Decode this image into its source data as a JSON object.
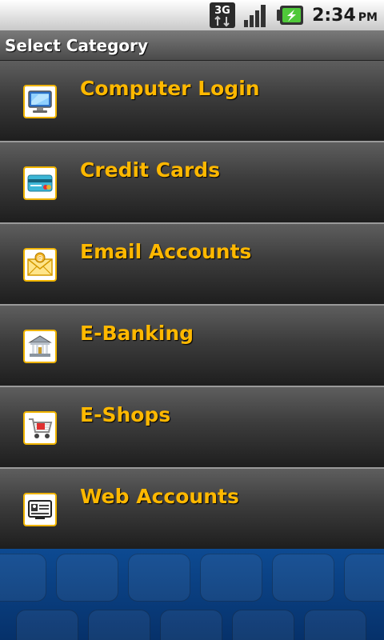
{
  "status_bar": {
    "network": "3G",
    "time": "2:34",
    "ampm": "PM",
    "icons": [
      "3g-data-icon",
      "signal-strength-icon",
      "battery-charging-icon"
    ]
  },
  "header": {
    "title": "Select Category"
  },
  "categories": [
    {
      "label": "Computer Login",
      "icon": "computer-monitor-icon"
    },
    {
      "label": "Credit Cards",
      "icon": "credit-card-icon"
    },
    {
      "label": "Email Accounts",
      "icon": "email-envelope-icon"
    },
    {
      "label": "E-Banking",
      "icon": "bank-building-icon"
    },
    {
      "label": "E-Shops",
      "icon": "shopping-cart-icon"
    },
    {
      "label": "Web Accounts",
      "icon": "web-id-card-icon"
    }
  ],
  "colors": {
    "label": "#ffb800",
    "icon_border": "#f0b400",
    "background": "#0a3a7a"
  }
}
